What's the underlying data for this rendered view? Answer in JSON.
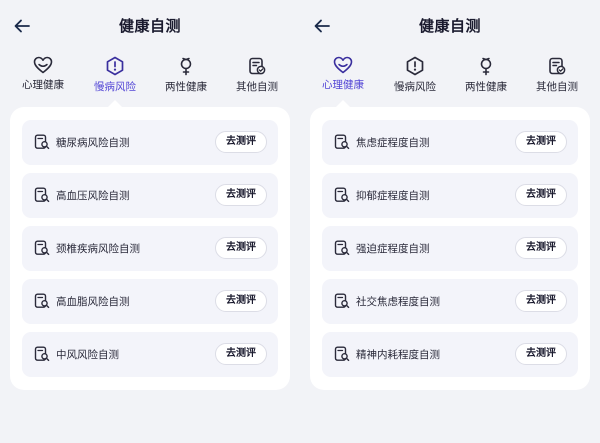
{
  "screens": [
    {
      "title": "健康自测",
      "active_tab": 1,
      "tabs": [
        {
          "label": "心理健康",
          "icon": "heart-icon"
        },
        {
          "label": "慢病风险",
          "icon": "hexagon-alert-icon"
        },
        {
          "label": "两性健康",
          "icon": "gender-icon"
        },
        {
          "label": "其他自测",
          "icon": "clipboard-check-icon"
        }
      ],
      "items": [
        {
          "label": "糖尿病风险自测",
          "button": "去测评"
        },
        {
          "label": "高血压风险自测",
          "button": "去测评"
        },
        {
          "label": "颈椎疾病风险自测",
          "button": "去测评"
        },
        {
          "label": "高血脂风险自测",
          "button": "去测评"
        },
        {
          "label": "中风风险自测",
          "button": "去测评"
        }
      ]
    },
    {
      "title": "健康自测",
      "active_tab": 0,
      "tabs": [
        {
          "label": "心理健康",
          "icon": "heart-icon"
        },
        {
          "label": "慢病风险",
          "icon": "hexagon-alert-icon"
        },
        {
          "label": "两性健康",
          "icon": "gender-icon"
        },
        {
          "label": "其他自测",
          "icon": "clipboard-check-icon"
        }
      ],
      "items": [
        {
          "label": "焦虑症程度自测",
          "button": "去测评"
        },
        {
          "label": "抑郁症程度自测",
          "button": "去测评"
        },
        {
          "label": "强迫症程度自测",
          "button": "去测评"
        },
        {
          "label": "社交焦虑程度自测",
          "button": "去测评"
        },
        {
          "label": "精神内耗程度自测",
          "button": "去测评"
        }
      ]
    }
  ],
  "colors": {
    "accent": "#5447d6",
    "text": "#1a1a2e",
    "background": "#f2f3f7",
    "card": "#f3f4fa"
  }
}
